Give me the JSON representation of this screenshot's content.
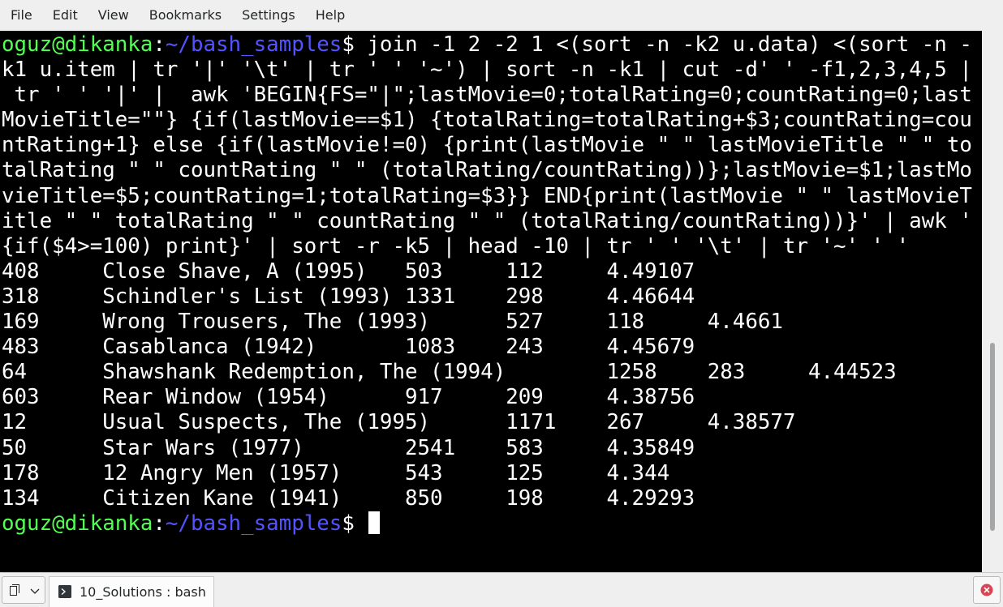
{
  "menu": {
    "file": "File",
    "edit": "Edit",
    "view": "View",
    "bookmarks": "Bookmarks",
    "settings": "Settings",
    "help": "Help"
  },
  "colors": {
    "terminal_bg": "#000000",
    "text": "#ffffff",
    "prompt_user": "#54ff54",
    "prompt_path": "#5454ff",
    "close_icon": "#da4453"
  },
  "terminal": {
    "prompt": {
      "user_host": "oguz@dikanka",
      "colon": ":",
      "path": "~/bash_samples",
      "symbol": "$ "
    },
    "command_lines": [
      "join -1 2 -2 1 <(sort -n -k2 u.data) <(sort -n -",
      "k1 u.item | tr '|' '\\t' | tr ' ' '~') | sort -n -k1 | cut -d' ' -f1,2,3,4,5 |",
      " tr ' ' '|' |  awk 'BEGIN{FS=\"|\";lastMovie=0;totalRating=0;countRating=0;last",
      "MovieTitle=\"\"} {if(lastMovie==$1) {totalRating=totalRating+$3;countRating=cou",
      "ntRating+1} else {if(lastMovie!=0) {print(lastMovie \" \" lastMovieTitle \" \" to",
      "talRating \" \" countRating \" \" (totalRating/countRating))};lastMovie=$1;lastMo",
      "vieTitle=$5;countRating=1;totalRating=$3}} END{print(lastMovie \" \" lastMovieT",
      "itle \" \" totalRating \" \" countRating \" \" (totalRating/countRating))}' | awk '",
      "{if($4>=100) print}' | sort -r -k5 | head -10 | tr ' ' '\\t' | tr '~' ' '"
    ],
    "output_lines": [
      "408     Close Shave, A (1995)   503     112     4.49107",
      "318     Schindler's List (1993) 1331    298     4.46644",
      "169     Wrong Trousers, The (1993)      527     118     4.4661",
      "483     Casablanca (1942)       1083    243     4.45679",
      "64      Shawshank Redemption, The (1994)        1258    283     4.44523",
      "603     Rear Window (1954)      917     209     4.38756",
      "12      Usual Suspects, The (1995)      1171    267     4.38577",
      "50      Star Wars (1977)        2541    583     4.35849",
      "178     12 Angry Men (1957)     543     125     4.344",
      "134     Citizen Kane (1941)     850     198     4.29293"
    ]
  },
  "tabbar": {
    "tab_label": "10_Solutions : bash",
    "new_tab_icon": "new-tab-icon",
    "tab_icon": "terminal-icon",
    "close_icon": "close-icon"
  }
}
